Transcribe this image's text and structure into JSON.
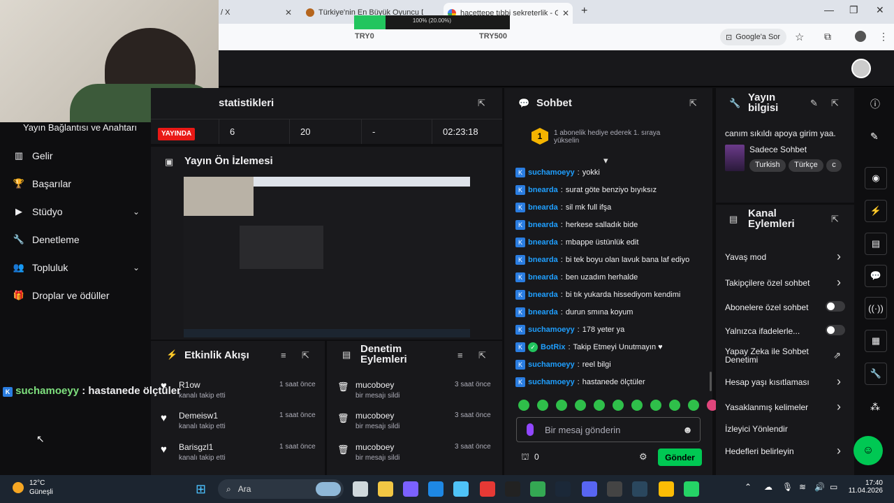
{
  "browser": {
    "tabs": [
      {
        "title": "/ X"
      },
      {
        "title": "Türkiye'nin En Büyük Oyuncu D..."
      },
      {
        "title": "hacettepe tıbbi sekreterlik - Go"
      }
    ],
    "google_button": "Google'a Sor",
    "progress": {
      "text": "100% (20.00%)",
      "fraction": 0.2,
      "left_label": "TRY0",
      "right_label": "TRY500"
    }
  },
  "sidebar": {
    "items": [
      {
        "label": "Yayın Bağlantısı ve Anahtarı",
        "icon": "none"
      },
      {
        "label": "Gelir",
        "icon": "chart-icon"
      },
      {
        "label": "Başarılar",
        "icon": "trophy-icon"
      },
      {
        "label": "Stüdyo",
        "icon": "video-icon",
        "expandable": true
      },
      {
        "label": "Denetleme",
        "icon": "wrench-icon"
      },
      {
        "label": "Topluluk",
        "icon": "people-icon",
        "expandable": true
      },
      {
        "label": "Droplar ve ödüller",
        "icon": "gift-icon"
      }
    ]
  },
  "stats": {
    "title": "statistikleri",
    "live_label": "YAYINDA",
    "values": [
      "6",
      "20",
      "-",
      "02:23:18"
    ]
  },
  "preview": {
    "title": "Yayın Ön İzlemesi"
  },
  "activity": {
    "title": "Etkinlik Akışı",
    "events": [
      {
        "name": "R1ow",
        "sub": "kanalı takip etti",
        "time": "1 saat önce"
      },
      {
        "name": "Demeisw1",
        "sub": "kanalı takip etti",
        "time": "1 saat önce"
      },
      {
        "name": "Barisgzl1",
        "sub": "kanalı takip etti",
        "time": "1 saat önce"
      }
    ]
  },
  "mod_actions": {
    "title": "Denetim Eylemleri",
    "events": [
      {
        "name": "mucoboey",
        "sub": "bir mesajı sildi",
        "time": "3 saat önce"
      },
      {
        "name": "mucoboey",
        "sub": "bir mesajı sildi",
        "time": "3 saat önce"
      },
      {
        "name": "mucoboey",
        "sub": "bir mesajı sildi",
        "time": "3 saat önce"
      }
    ]
  },
  "chat": {
    "title": "Sohbet",
    "gift_banner": "1 abonelik hediye ederek 1. sıraya yükselin",
    "gift_rank": "1",
    "messages": [
      {
        "user": "suchamoeyy",
        "text": "yokki"
      },
      {
        "user": "bnearda",
        "text": "surat göte benziyo bıyıksız"
      },
      {
        "user": "bnearda",
        "text": "sil mk full ifşa"
      },
      {
        "user": "bnearda",
        "text": "herkese salladık bide"
      },
      {
        "user": "bnearda",
        "text": "mbappe üstünlük edit"
      },
      {
        "user": "bnearda",
        "text": "bi tek boyu olan lavuk bana laf ediyo"
      },
      {
        "user": "bnearda",
        "text": "ben uzadım herhalde"
      },
      {
        "user": "bnearda",
        "text": "bi tık yukarda hissediyom kendimi"
      },
      {
        "user": "bnearda",
        "text": "durun smına koyum"
      },
      {
        "user": "suchamoeyy",
        "text": "178 yeter ya"
      },
      {
        "user": "BotRix",
        "text": "Takip Etmeyi Unutmayın ♥"
      },
      {
        "user": "suchamoeyy",
        "text": "reel bilgi"
      },
      {
        "user": "suchamoeyy",
        "text": "hastanede ölçtüler"
      }
    ],
    "input_placeholder": "Bir mesaj gönderin",
    "points": "0",
    "send_label": "Gönder"
  },
  "stream_info": {
    "title": "Yayın bilgisi",
    "stream_title": "canım sıkıldı apoya girim yaa.",
    "category": "Sadece Sohbet",
    "tags": [
      "Turkish",
      "Türkçe",
      "c"
    ]
  },
  "channel_actions": {
    "title": "Kanal Eylemleri",
    "items": [
      {
        "label": "Yavaş mod",
        "control": "arrow"
      },
      {
        "label": "Takipçilere özel sohbet",
        "control": "arrow"
      },
      {
        "label": "Abonelere özel sohbet",
        "control": "toggle"
      },
      {
        "label": "Yalnızca ifadelerle...",
        "control": "toggle"
      },
      {
        "label": "Yapay Zeka ile Sohbet Denetimi",
        "control": "external"
      },
      {
        "label": "Hesap yaşı kısıtlaması",
        "control": "arrow"
      },
      {
        "label": "Yasaklanmış kelimeler",
        "control": "arrow"
      },
      {
        "label": "İzleyici Yönlendir",
        "control": "none"
      },
      {
        "label": "Hedefleri belirleyin",
        "control": "arrow"
      }
    ]
  },
  "overlay_chat": {
    "user": "suchamoeyy",
    "text": ": hastanede ölçtüler"
  },
  "taskbar": {
    "weather_temp": "12°C",
    "weather_desc": "Güneşli",
    "search_label": "Ara",
    "time": "17:40",
    "date": "11.04.2026"
  },
  "colors": {
    "accent_green": "#00c853",
    "live_red": "#e91916",
    "chat_user": "#1f9fff"
  }
}
